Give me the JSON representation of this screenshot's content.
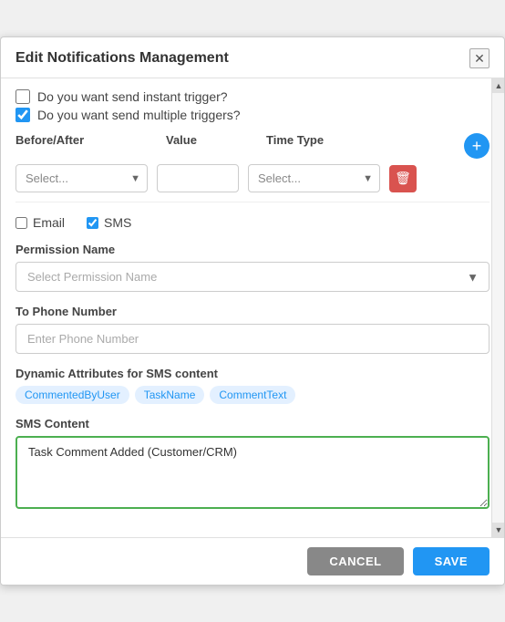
{
  "modal": {
    "title": "Edit Notifications Management",
    "close_label": "✕"
  },
  "triggers": {
    "instant_label": "Do you want send instant trigger?",
    "multiple_label": "Do you want send multiple triggers?",
    "instant_checked": false,
    "multiple_checked": true
  },
  "timing": {
    "col_before_after": "Before/After",
    "col_value": "Value",
    "col_time_type": "Time Type",
    "select_before_after_placeholder": "Select...",
    "select_time_type_placeholder": "Select...",
    "add_btn_label": "+"
  },
  "channels": {
    "email_label": "Email",
    "sms_label": "SMS",
    "email_checked": false,
    "sms_checked": true
  },
  "permission": {
    "label": "Permission Name",
    "placeholder": "Select Permission Name"
  },
  "phone": {
    "label": "To Phone Number",
    "placeholder": "Enter Phone Number"
  },
  "dynamic_attrs": {
    "label": "Dynamic Attributes for SMS content",
    "tags": [
      "CommentedByUser",
      "TaskName",
      "CommentText"
    ]
  },
  "sms_content": {
    "label": "SMS Content",
    "value": "Task Comment Added (Customer/CRM)"
  },
  "footer": {
    "cancel_label": "CANCEL",
    "save_label": "SAVE"
  }
}
